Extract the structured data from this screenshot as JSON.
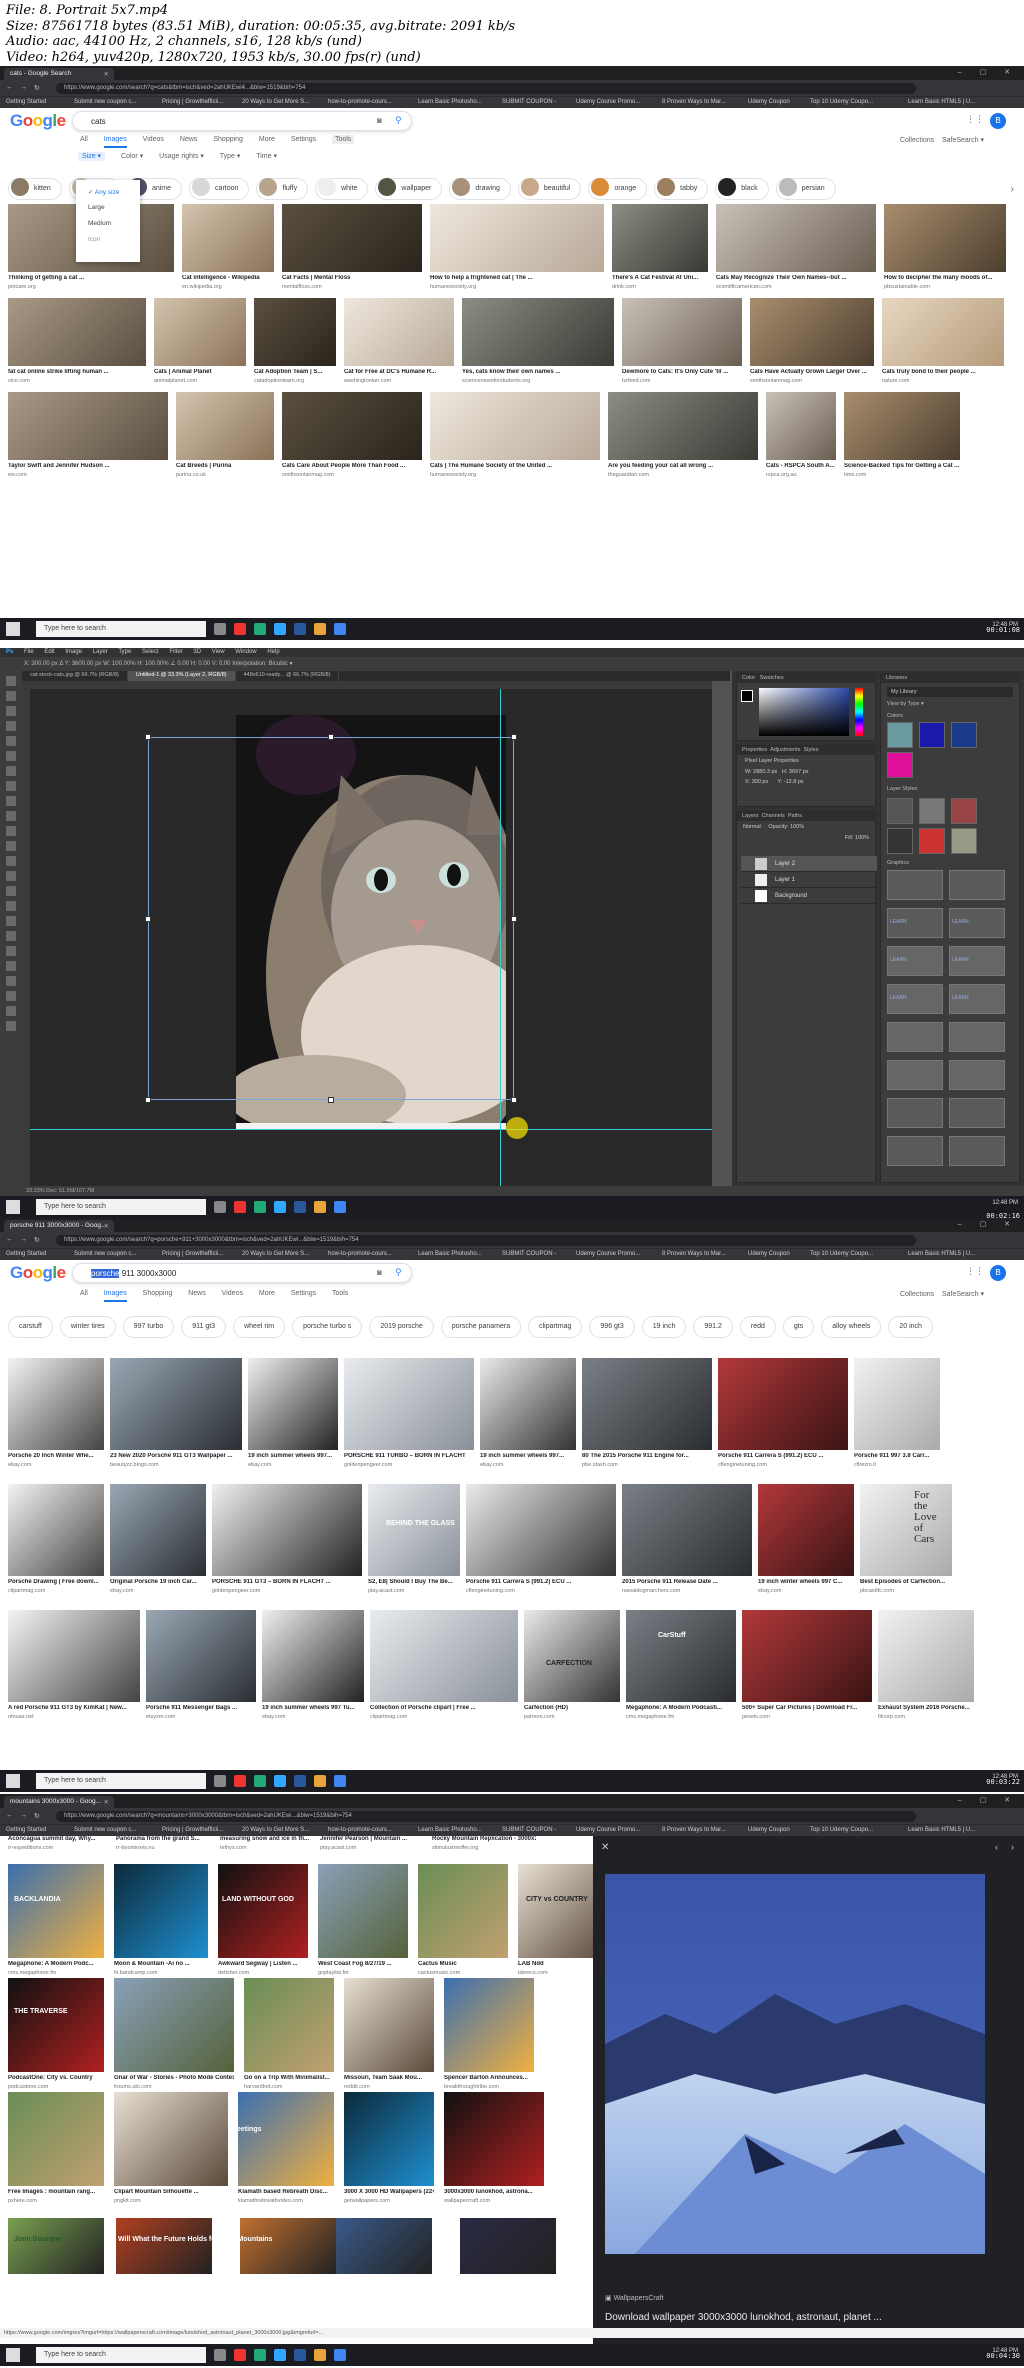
{
  "header": {
    "lines": [
      "File: 8. Portrait 5x7.mp4",
      "Size: 87561718 bytes (83.51 MiB), duration: 00:05:35, avg.bitrate: 2091 kb/s",
      "Audio: aac, 44100 Hz, 2 channels, s16, 128 kb/s (und)",
      "Video: h264, yuv420p, 1280x720, 1953 kb/s, 30.00 fps(r) (und)"
    ]
  },
  "bookmarks": [
    "Getting Started",
    "Submit new coupon c...",
    "Pricing | Growthefficii...",
    "20 Ways to Get More S...",
    "how-to-promote-cours...",
    "Learn Basic Photosho...",
    "SUBMIT COUPON -",
    "Udemy Course Promo...",
    "8 Proven Ways to Mar...",
    "Udemy Coupon",
    "Top 10 Udemy Coupo...",
    "Learn Basic HTML5 | U..."
  ],
  "taskbar": {
    "search_placeholder": "Type here to search",
    "time": "12:48 PM"
  },
  "timestamps": [
    "00:01:08",
    "00:02:16",
    "00:03:22",
    "00:04:30"
  ],
  "frame1": {
    "tab_title": "cats - Google Search",
    "url": "https://www.google.com/search?q=cats&tbm=isch&ved=2ahUKEwi4...&biw=1519&bih=754",
    "logo": "Google",
    "query": "cats",
    "tabs": [
      "All",
      "Images",
      "Videos",
      "News",
      "Shopping",
      "More",
      "Settings",
      "Tools"
    ],
    "right": {
      "collections": "Collections",
      "safesearch": "SafeSearch ▾"
    },
    "avatar": "B",
    "filters": [
      "Size ▾",
      "Color ▾",
      "Usage rights ▾",
      "Type ▾",
      "Time ▾"
    ],
    "size_menu": [
      "Any size",
      "Large",
      "Medium",
      "Icon"
    ],
    "chips": [
      "kitten",
      "cute",
      "anime",
      "cartoon",
      "fluffy",
      "white",
      "wallpaper",
      "drawing",
      "beautiful",
      "orange",
      "tabby",
      "black",
      "persian"
    ],
    "rows": [
      [
        {
          "cap": "Thinking of getting a cat ...",
          "src": "petcare.org"
        },
        {
          "cap": "Cat intelligence - Wikipedia",
          "src": "en.wikipedia.org"
        },
        {
          "cap": "Cat Facts | Mental Floss",
          "src": "mentalfloss.com"
        },
        {
          "cap": "How to help a frightened cat | The ...",
          "src": "humanesociety.org"
        },
        {
          "cap": "There's A Cat Festival At Uni...",
          "src": "drink.com"
        },
        {
          "cap": "Cats May Recognize Their Own Names--but ...",
          "src": "scientificamerican.com"
        },
        {
          "cap": "How to decipher the many moods of...",
          "src": "pbsustainable.com"
        }
      ],
      [
        {
          "cap": "fat cat online strike lifting human ...",
          "src": "vice.com"
        },
        {
          "cap": "Cats | Animal Planet",
          "src": "animalplanet.com"
        },
        {
          "cap": "Cat Adoption Team | S...",
          "src": "catadoptionteam.org"
        },
        {
          "cap": "Cat for Free at DC's Humane R...",
          "src": "washingtonian.com"
        },
        {
          "cap": "Yes, cats know their own names ...",
          "src": "sciencenewsforstudents.org"
        },
        {
          "cap": "Dewmore to Cats: It's Only Cute 'til ...",
          "src": "bzfeed.com"
        },
        {
          "cap": "Cats Have Actually Grown Larger Over ...",
          "src": "smithsonianmag.com"
        },
        {
          "cap": "Cats truly bond to their people ...",
          "src": "nature.com"
        }
      ],
      [
        {
          "cap": "Taylor Swift and Jennifer Hudson ...",
          "src": "ew.com"
        },
        {
          "cap": "Cat Breeds | Purina",
          "src": "purina.co.uk"
        },
        {
          "cap": "Cats Care About People More Than Food ...",
          "src": "smithsonianmag.com"
        },
        {
          "cap": "Cats | The Humane Society of the United ...",
          "src": "humanesociety.org"
        },
        {
          "cap": "Are you feeding your cat all wrong ...",
          "src": "theguardian.com"
        },
        {
          "cap": "Cats - RSPCA South A...",
          "src": "rspca.org.au"
        },
        {
          "cap": "Science-Backed Tips for Getting a Cat ...",
          "src": "time.com"
        }
      ]
    ]
  },
  "frame2": {
    "menu": [
      "File",
      "Edit",
      "Image",
      "Layer",
      "Type",
      "Select",
      "Filter",
      "3D",
      "View",
      "Window",
      "Help"
    ],
    "options": "X: 300.00 px   Δ  Y: 3600.00 px   W: 100.00%   H: 100.00%   ∠ 0.00   H: 0.00   V: 0.00   Interpolation:  Bicubic ▾",
    "doc_tabs": [
      "cat-stock-cats.jpg @ 66.7% (RGB/8)",
      "Untitled-1 @ 33.3% (Layer 2, RGB/8)",
      "448x610-ready... @ 66.7% (RGB/8)"
    ],
    "panels": {
      "color": "Color",
      "swatches": "Swatches",
      "properties": "Properties",
      "adjustments": "Adjustments",
      "styles": "Styles",
      "pixel_layer": "Pixel Layer Properties",
      "w": "W: 2880.3 px",
      "h": "H: 3697 px",
      "x": "X: 300 px",
      "y": "Y: -12.8 px",
      "layers": "Layers",
      "channels": "Channels",
      "paths": "Paths",
      "blend": "Normal",
      "opacity": "Opacity: 100%",
      "fill": "Fill: 100%",
      "layer_names": [
        "Layer 2",
        "Layer 1",
        "Background"
      ],
      "libraries": "Libraries",
      "library_name": "My Library",
      "view_by": "View by Type ▾",
      "colors": "Colors",
      "layer_styles": "Layer Styles",
      "graphics": "Graphics",
      "learn": "LEARN"
    },
    "status": "33.33%    Doc: 51.5M/107.7M"
  },
  "frame3": {
    "tab_title": "porsche 911 3000x3000 - Goog...",
    "url": "https://www.google.com/search?q=porsche+911+3000x3000&tbm=isch&ved=2ahUKEwi...&biw=1519&bih=754",
    "query_highlight": "porsche",
    "query_rest": " 911 3000x3000",
    "tabs": [
      "All",
      "Images",
      "Shopping",
      "News",
      "Videos",
      "More",
      "Settings",
      "Tools"
    ],
    "chips": [
      "carstuff",
      "winter tires",
      "997 turbo",
      "911 gt3",
      "wheel rim",
      "porsche turbo s",
      "2019 porsche",
      "porsche panamera",
      "clipartmag",
      "996 gt3",
      "19 inch",
      "991.2",
      "redd",
      "gts",
      "alloy wheels",
      "20 inch"
    ],
    "rows": [
      [
        {
          "cap": "Porsche 20 Inch Winter Whe...",
          "src": "ebay.com"
        },
        {
          "cap": "23 New 2020 Porsche 911 GT3 Wallpaper ...",
          "src": "beautyzz.blogs.com"
        },
        {
          "cap": "19 inch summer wheels 997...",
          "src": "ebay.com"
        },
        {
          "cap": "PORSCHE 911 TURBO – BORN IN FLACHT",
          "src": "goldenpengeer.com"
        },
        {
          "cap": "19 inch summer wheels 997...",
          "src": "ebay.com"
        },
        {
          "cap": "80 The 2015 Porsche 911 Engine for...",
          "src": "pbe.stash.com"
        },
        {
          "cap": "Porsche 911 Carrera S (991.2) ECU ...",
          "src": "cflenginetuning.com"
        },
        {
          "cap": "Porsche 911 997 3.8 Carr...",
          "src": "cflrezrs.lt"
        }
      ],
      [
        {
          "cap": "Porsche Drawing | Free downl...",
          "src": "clipartmag.com"
        },
        {
          "cap": "Original Porsche 19 inch Car...",
          "src": "ebay.com"
        },
        {
          "cap": "PORSCHE 911 GT3 – BORN IN FLACHT ...",
          "src": "goldenpengeer.com"
        },
        {
          "cap": "S2, E8| Should I Buy The Be...",
          "src": "play.acast.com"
        },
        {
          "cap": "Porsche 911 Carrera S (991.2) ECU ...",
          "src": "cflenginetuning.com"
        },
        {
          "cap": "2015 Porsche 911 Release Date ...",
          "src": "nawaldogmarchers.com"
        },
        {
          "cap": "19 inch winter wheels 997 C...",
          "src": "ebay.com"
        },
        {
          "cap": "Best Episodes of Carfection...",
          "src": "pbcasttfc.com"
        }
      ],
      [
        {
          "cap": "A red Porsche 911 GT3 by KimKat | New...",
          "src": "nfeuas.net"
        },
        {
          "cap": "Porsche 911 Messenger Bags ...",
          "src": "etsyxm.com"
        },
        {
          "cap": "19 inch summer wheels 997 Tu...",
          "src": "ebay.com"
        },
        {
          "cap": "Collection of Porsche clipart | Free ...",
          "src": "clipartmag.com"
        },
        {
          "cap": "Carfection (HD)",
          "src": "patreon.com"
        },
        {
          "cap": "Megaphone: A Modern Podcasti...",
          "src": "cms.megaphone.fm"
        },
        {
          "cap": "500+ Super Car Pictures | Download Fr...",
          "src": "pexels.com"
        },
        {
          "cap": "Exhaust System 2016 Porsche...",
          "src": "fitcorp.com"
        }
      ]
    ],
    "logo_text": "CARFECTION",
    "carstuff": "CarStuff",
    "behind_the_glass": "BEHIND THE GLASS",
    "love_of_cars": [
      "For",
      "the",
      "Love",
      "of",
      "Cars"
    ]
  },
  "frame4": {
    "tab_title": "mountains 3000x3000 - Goog...",
    "url": "https://www.google.com/search?q=mountains+3000x3000&tbm=isch&ved=2ahUKEwi...&biw=1519&bih=754",
    "toprow": [
      {
        "cap": "Aconcagua summit day, Why...",
        "src": "rr-expeditions.com"
      },
      {
        "cap": "Panorama from the grand S...",
        "src": "rr-boomkreis.nu"
      },
      {
        "cap": "measuring snow and ice in th...",
        "src": "tethys.com"
      },
      {
        "cap": "Jennifer Pearson | Mountain ...",
        "src": "play.acast.com"
      },
      {
        "cap": "Rocky Mountain Replication - 3000x3000 ...",
        "src": "stimulustmoffer.org"
      }
    ],
    "rows": [
      [
        {
          "cap": "Megaphone: A Modern Podc...",
          "src": "cms.megaphone.fm"
        },
        {
          "cap": "Moon & Mountain -Ai no ...",
          "src": "hi.bandcamp.com"
        },
        {
          "cap": "Awkward Segway | Listen ...",
          "src": "deltsher.com"
        },
        {
          "cap": "West Coast Fog 8/27/19 ...",
          "src": "goplaylist.fm"
        },
        {
          "cap": "Cactus Music",
          "src": "cactusmusic.com"
        },
        {
          "cap": "LAB Ndd",
          "src": "labrecs.com"
        }
      ],
      [
        {
          "cap": "PodcastOne: City vs. Country",
          "src": "podcastone.com"
        },
        {
          "cap": "Gnar of War - Stories - Photo Mode Contest",
          "src": "forums.ubi.com"
        },
        {
          "cap": "Go on a Trip With Minimalist...",
          "src": "harvardhrd.com"
        },
        {
          "cap": "Missouri, Team Saak Mou...",
          "src": "reddit.com"
        },
        {
          "cap": "Spencer Barton Announces...",
          "src": "breakthroughtribe.com"
        }
      ],
      [
        {
          "cap": "Free Images : mountain rang...",
          "src": "pxhere.com"
        },
        {
          "cap": "Clipart Mountain Silhouette ...",
          "src": "pngkit.com"
        },
        {
          "cap": "Klamath based Rebreath Disc...",
          "src": "klamathrebreathvideo.com"
        },
        {
          "cap": "3000 X 3000 HD Wallpapers (22+ Images)",
          "src": "getwallpapers.com"
        },
        {
          "cap": "3000x3000 lunokhod, astrona...",
          "src": "wallpapercraft.com"
        }
      ]
    ],
    "badge_texts": [
      "BACKLANDIA",
      "AWKWARD SEGWAY",
      "LAND WITHOUT GOD",
      "CITY vs COUNTRY",
      "THE TRAVERSE",
      "greetings",
      "Jonn Bourque",
      "Will What the Future Holds for Your Mountains"
    ],
    "viewer": {
      "site": "WallpapersCraft",
      "title": "Download wallpaper 3000x3000 lunokhod, astronaut, planet ..."
    },
    "status_url": "https://www.google.com/imgres?imgurl=https://wallpaperscraft.com/image/lunokhod_astronaut_planet_3000x3000.jpg&imgrefurl=..."
  },
  "colors": {
    "google_blue": "#4285f4",
    "google_red": "#ea4335",
    "google_yellow": "#fbbc05",
    "google_green": "#34a853",
    "swatch_row1": [
      "#6a9aa0",
      "#1a1aa8",
      "#1a3a8a"
    ],
    "swatch_row2": [
      "#e0109a"
    ]
  }
}
